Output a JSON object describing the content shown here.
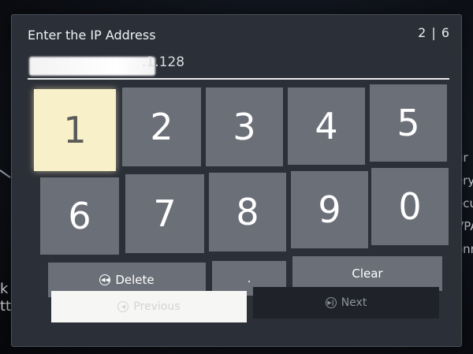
{
  "background": {
    "right_fragments": "gr\nery\necu\nVPA\nonn",
    "left_fragments": "k\ntted)"
  },
  "dialog": {
    "title": "Enter the IP Address",
    "step": "2 | 6",
    "ip_visible_suffix": ".1.128"
  },
  "keypad": {
    "row1": [
      "1",
      "2",
      "3",
      "4",
      "5"
    ],
    "row2": [
      "6",
      "7",
      "8",
      "9",
      "0"
    ],
    "delete_label": "Delete",
    "dot_label": ".",
    "clear_label": "Clear"
  },
  "nav": {
    "previous_label": "Previous",
    "next_label": "Next"
  },
  "colors": {
    "key_bg": "#6b6f78",
    "key_focused_bg": "#f8f0c8",
    "dialog_bg": "#2b2f37"
  },
  "icons": {
    "delete": "rewind-circle-icon",
    "previous": "previous-circle-icon",
    "next": "play-pause-circle-icon"
  }
}
